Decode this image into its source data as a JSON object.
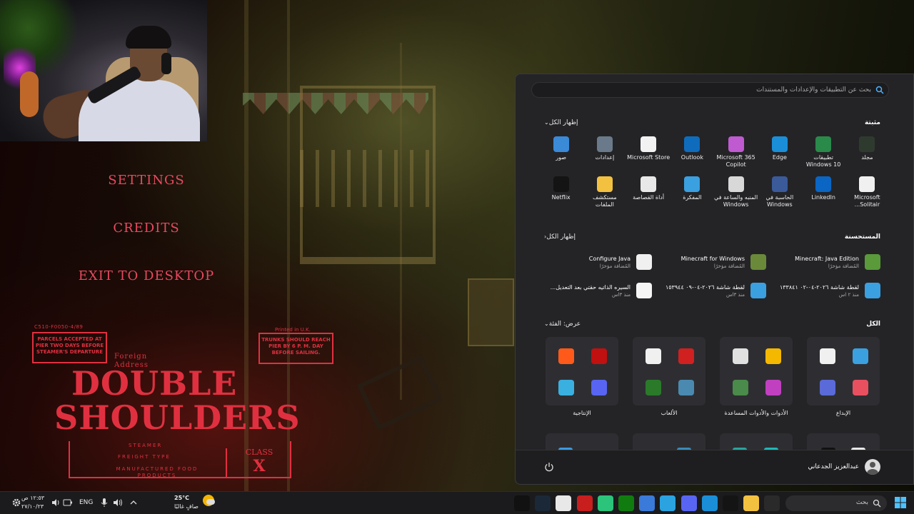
{
  "game": {
    "menu": [
      "SETTINGS",
      "CREDITS",
      "EXIT TO DESKTOP"
    ],
    "poster": {
      "code": "C510-F0050-4/89",
      "left_box": "PARCELS ACCEPTED AT PIER TWO DAYS BEFORE STEAMER'S DEPARTURE",
      "printed": "Printed in U.K.",
      "right_box": "TRUNKS SHOULD REACH PIER BY 6 P. M. DAY BEFORE SAILING.",
      "foreign": "Foreign",
      "address": "Address",
      "title_line1": "DOUBLE",
      "title_line2": "SHOULDERS",
      "steamer": "STEAMER",
      "freight": "FREIGHT TYPE",
      "manufactured": "MANUFACTURED FOOD PRODUCTS",
      "class_label": "CLASS",
      "class_value": "X"
    }
  },
  "start_menu": {
    "search_placeholder": "بحث عن التطبيقات والإعدادات والمستندات",
    "pinned": {
      "title": "مثبتة",
      "show_all": "إظهار الكل",
      "apps": [
        {
          "label": "مجلد",
          "icon": "folder-icon",
          "color": "#2f3a2f"
        },
        {
          "label": "تطبيقات Windows 10",
          "icon": "windows10-apps-icon",
          "color": "#2a8a4a"
        },
        {
          "label": "Edge",
          "icon": "edge-icon",
          "color": "#1a8fd8"
        },
        {
          "label": "Microsoft 365 Copilot",
          "icon": "m365-copilot-icon",
          "color": "#c05ad0"
        },
        {
          "label": "Outlook",
          "icon": "outlook-icon",
          "color": "#0f6cbd"
        },
        {
          "label": "Microsoft Store",
          "icon": "store-icon",
          "color": "#f2f2f2"
        },
        {
          "label": "إعدادات",
          "icon": "settings-gear-icon",
          "color": "#6a7a8a"
        },
        {
          "label": "صور",
          "icon": "photos-icon",
          "color": "#3a8ad8"
        },
        {
          "label": "Microsoft Solitair...",
          "icon": "solitaire-icon",
          "color": "#f0f0f0"
        },
        {
          "label": "LinkedIn",
          "icon": "linkedin-icon",
          "color": "#0a66c2"
        },
        {
          "label": "الحاسبة في Windows",
          "icon": "calculator-icon",
          "color": "#3a5a9a"
        },
        {
          "label": "المنبه والساعة في Windows",
          "icon": "clock-icon",
          "color": "#d8d8d8"
        },
        {
          "label": "المفكرة",
          "icon": "notepad-icon",
          "color": "#3aa0e0"
        },
        {
          "label": "أداة القصاصة",
          "icon": "snipping-tool-icon",
          "color": "#e8e8e8"
        },
        {
          "label": "مستكشف الملفات",
          "icon": "file-explorer-icon",
          "color": "#f3c140"
        },
        {
          "label": "Netflix",
          "icon": "netflix-icon",
          "color": "#141414"
        }
      ]
    },
    "recommended": {
      "title": "المستحسنة",
      "show_all": "إظهار الكل",
      "items": [
        {
          "title": "Minecraft: Java Edition",
          "subtitle": "المُضافة مؤخرًا",
          "icon": "minecraft-java-icon",
          "color": "#5a9a3a"
        },
        {
          "title": "Minecraft for Windows",
          "subtitle": "المُضافة مؤخرًا",
          "icon": "minecraft-windows-icon",
          "color": "#6a8a3a"
        },
        {
          "title": "Configure Java",
          "subtitle": "المُضافة مؤخرًا",
          "icon": "java-icon",
          "color": "#f0f0f0"
        },
        {
          "title": "لقطة شاشة ٢٠٢٦-٠٤-٠٢ ١٣٣٨٤١",
          "subtitle": "منذ ٢ اس",
          "icon": "screenshot-icon",
          "color": "#3aa0e0"
        },
        {
          "title": "لقطة شاشة ٢٠٢٦-٠٤-٠٩ ١٥٣٩٤٤",
          "subtitle": "منذ ٣اس",
          "icon": "screenshot-icon",
          "color": "#3aa0e0"
        },
        {
          "title": "السيره الذاتيه حقتي بعد التعديل...",
          "subtitle": "منذ ٣اس",
          "icon": "chrome-doc-icon",
          "color": "#f5f5f5"
        }
      ]
    },
    "all": {
      "title": "الكل",
      "view": "عرض: الفئة",
      "folders": [
        {
          "label": "الإبداع",
          "icons": [
            "#3aa0e0",
            "#f0f0f0",
            "#e85060",
            "#5a6ad8"
          ]
        },
        {
          "label": "الأدوات والأدوات المساعدة",
          "icons": [
            "#f5b800",
            "#e0e0e0",
            "#c040c0",
            "#4a8a4a"
          ]
        },
        {
          "label": "الألعاب",
          "icons": [
            "#d02020",
            "#f0f0f0",
            "#4a8ab0",
            "#2a7a2a"
          ]
        },
        {
          "label": "الإنتاجية",
          "icons": [
            "#c01010",
            "#ff5a1a",
            "#5865f2",
            "#3ab0e0"
          ]
        }
      ]
    },
    "user": "عبدالعزيز الجدعاني"
  },
  "taskbar": {
    "search_placeholder": "بحث",
    "clock_time": "١٢:٥٣ ص",
    "clock_date": "٢٧/١٠/٢٣",
    "language": "ENG",
    "temperature": "25°C",
    "weather": "صافٍ غالبًا",
    "apps": [
      {
        "name": "unreal-icon",
        "color": "#111"
      },
      {
        "name": "steam-icon",
        "color": "#1b2838"
      },
      {
        "name": "chrome-icon",
        "color": "#e8e8e8"
      },
      {
        "name": "video-editor-icon",
        "color": "#c81e1e"
      },
      {
        "name": "teams-icon",
        "color": "#2bc47a"
      },
      {
        "name": "xbox-icon",
        "color": "#107c10"
      },
      {
        "name": "messages-icon",
        "color": "#3a7ad8"
      },
      {
        "name": "telegram-icon",
        "color": "#2aa3e0"
      },
      {
        "name": "discord-icon",
        "color": "#5865f2"
      },
      {
        "name": "edge-icon",
        "color": "#1a8fd8"
      },
      {
        "name": "netflix-icon",
        "color": "#141414"
      },
      {
        "name": "file-explorer-icon",
        "color": "#f3c140"
      },
      {
        "name": "store-icon",
        "color": "#2a2a2a"
      }
    ]
  }
}
